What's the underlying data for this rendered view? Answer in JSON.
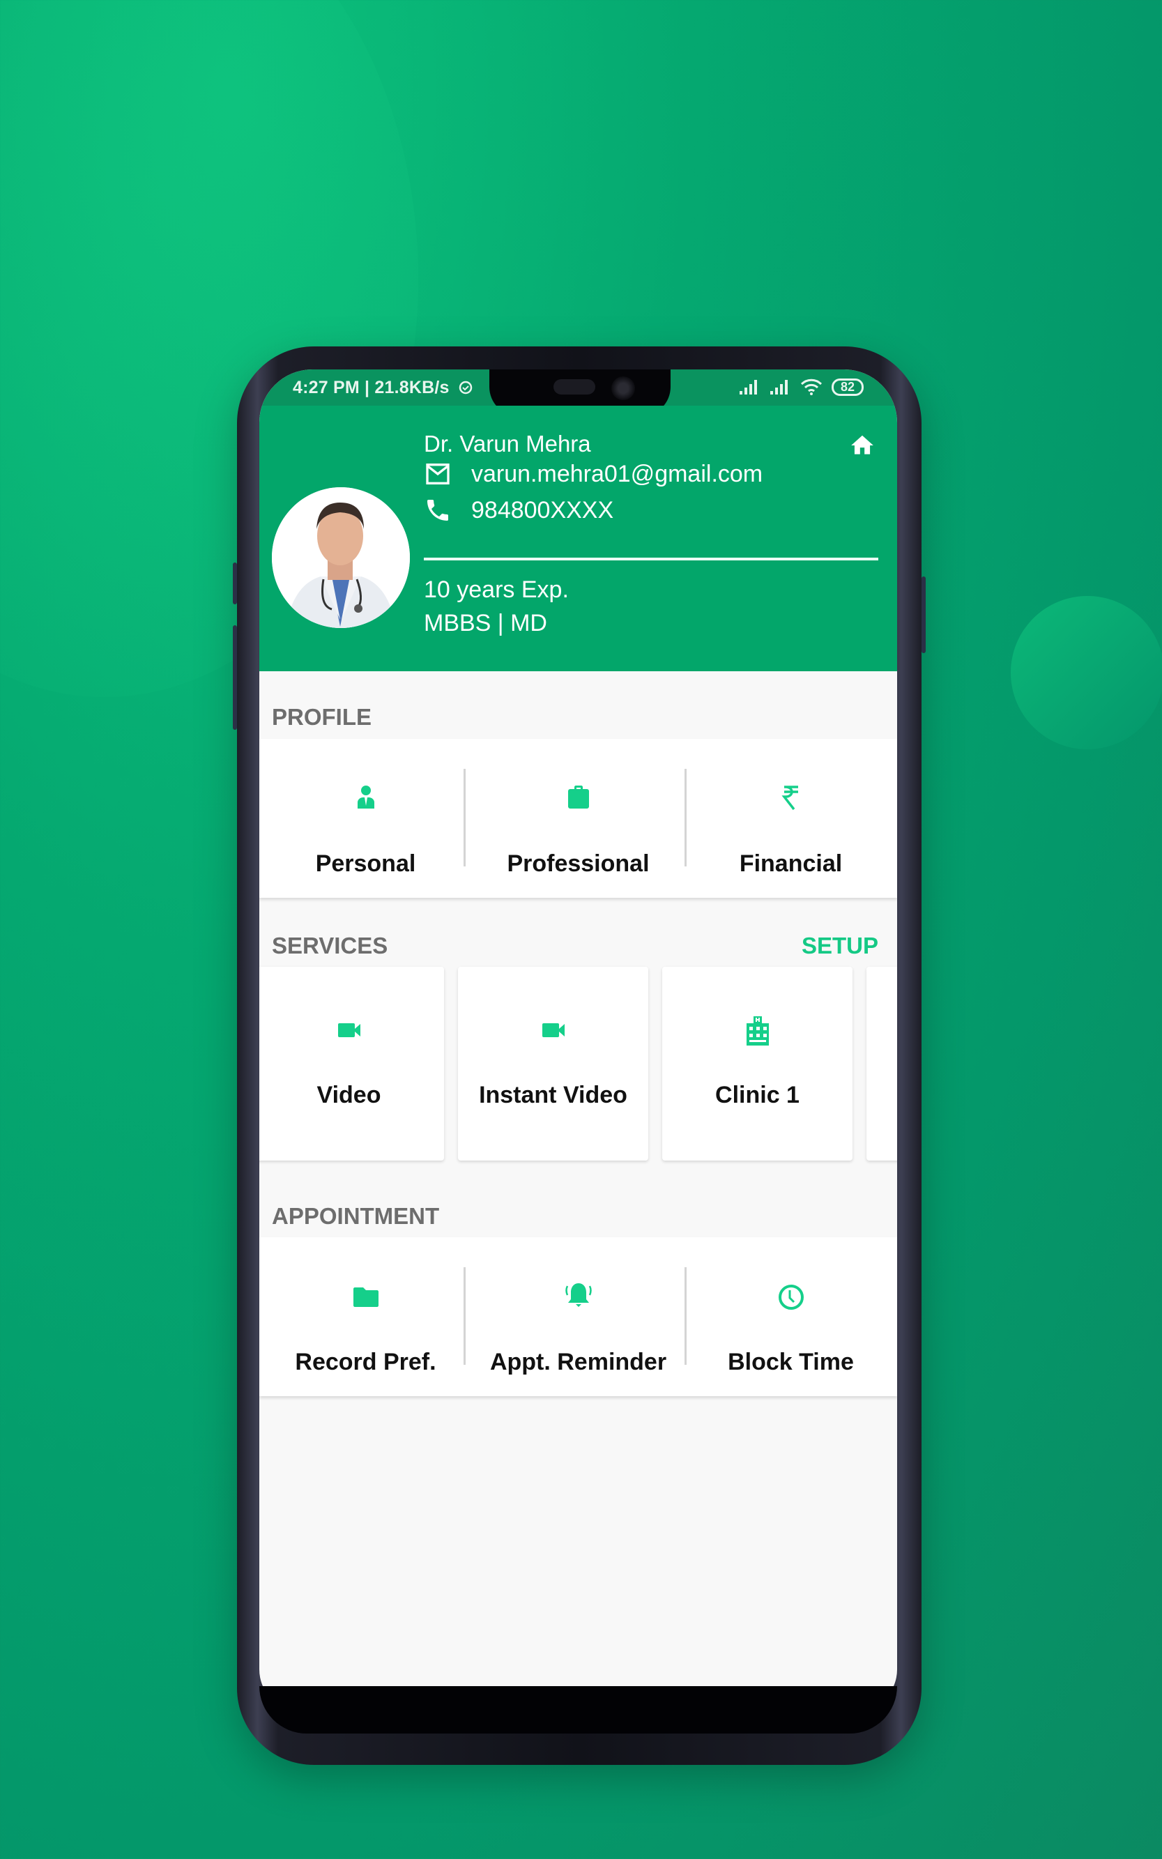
{
  "status_bar": {
    "time_speed": "4:27 PM | 21.8KB/s",
    "battery": "82",
    "icons": [
      "alarm-icon",
      "signal-icon",
      "signal-icon",
      "wifi-icon",
      "battery-icon"
    ]
  },
  "profile_header": {
    "name": "Dr. Varun Mehra",
    "email": "varun.mehra01@gmail.com",
    "phone": "984800XXXX",
    "experience": "10 years Exp.",
    "degrees": "MBBS | MD",
    "home_icon": "home-icon"
  },
  "sections": {
    "profile": {
      "title": "PROFILE",
      "items": [
        {
          "label": "Personal",
          "icon": "person-icon"
        },
        {
          "label": "Professional",
          "icon": "briefcase-icon"
        },
        {
          "label": "Financial",
          "icon": "rupee-icon"
        }
      ]
    },
    "services": {
      "title": "SERVICES",
      "action": "SETUP",
      "items": [
        {
          "label": "Video",
          "icon": "videocam-icon"
        },
        {
          "label": "Instant Video",
          "icon": "videocam-icon"
        },
        {
          "label": "Clinic 1",
          "icon": "hospital-icon"
        }
      ]
    },
    "appointment": {
      "title": "APPOINTMENT",
      "items": [
        {
          "label": "Record Pref.",
          "icon": "folder-icon"
        },
        {
          "label": "Appt. Reminder",
          "icon": "bell-ring-icon"
        },
        {
          "label": "Block Time",
          "icon": "clock-icon"
        }
      ]
    }
  },
  "colors": {
    "brand_green": "#03a66a",
    "status_bar": "#0a935f",
    "accent": "#15c985",
    "section_title": "#6d6d6d"
  }
}
